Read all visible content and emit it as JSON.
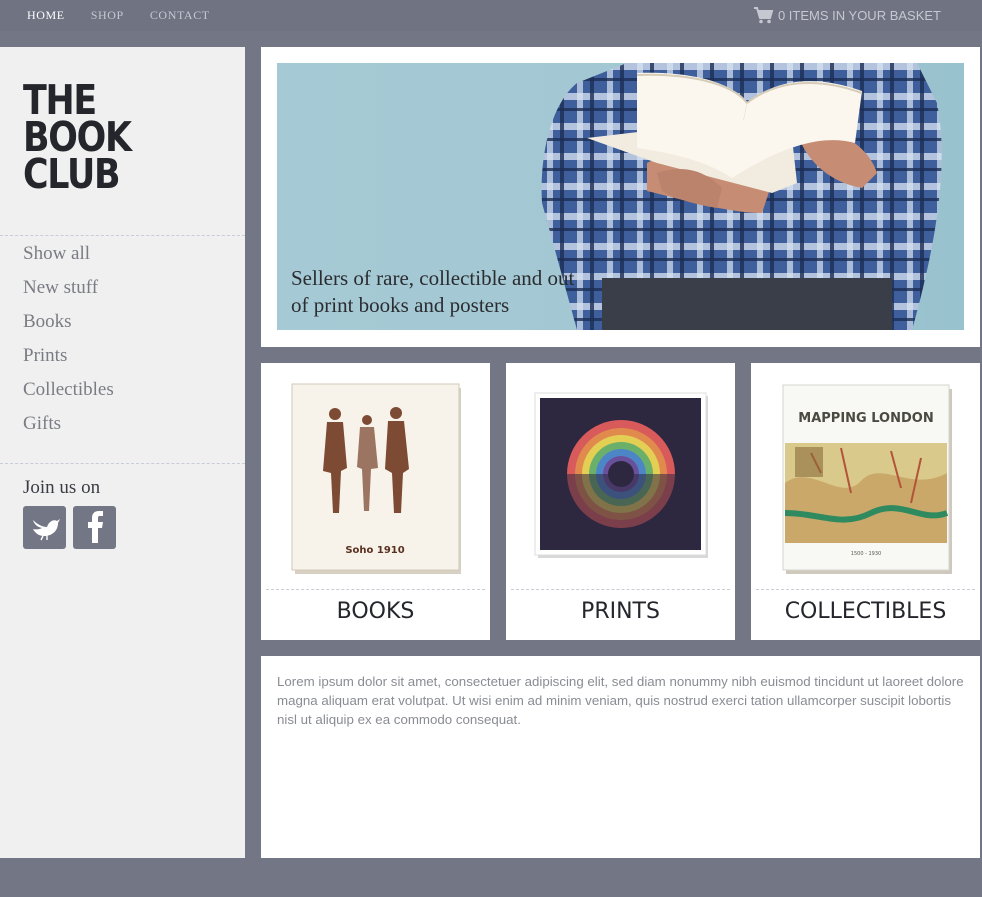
{
  "nav": {
    "items": [
      {
        "label": "HOME",
        "active": true
      },
      {
        "label": "SHOP",
        "active": false
      },
      {
        "label": "CONTACT",
        "active": false
      }
    ],
    "basket": {
      "icon": "cart-icon",
      "label": "0 ITEMS IN YOUR BASKET"
    }
  },
  "sidebar": {
    "logo": [
      "THE",
      "BOOK",
      "CLUB"
    ],
    "menu": [
      "Show all",
      "New stuff",
      "Books",
      "Prints",
      "Collectibles",
      "Gifts"
    ],
    "join_label": "Join us on",
    "social": [
      {
        "icon": "twitter-bird-icon"
      },
      {
        "icon": "facebook-icon"
      }
    ]
  },
  "hero": {
    "caption_line1": "Sellers of rare, collectible and out",
    "caption_line2": "of print books and posters"
  },
  "categories": [
    {
      "label": "BOOKS",
      "cover_text": "Soho 1910"
    },
    {
      "label": "PRINTS"
    },
    {
      "label": "COLLECTIBLES",
      "cover_title": "MAPPING LONDON",
      "cover_sub": "1500 - 1930"
    }
  ],
  "body_text": "Lorem ipsum dolor sit amet, consectetuer adipiscing elit, sed diam nonummy nibh euismod tincidunt ut laoreet dolore magna aliquam erat volutpat. Ut wisi enim ad minim veniam, quis nostrud exerci tation ullamcorper suscipit lobortis nisl ut aliquip ex ea commodo consequat.",
  "colors": {
    "frame": "#737785",
    "sidebar": "#f0f0f0",
    "hero_bg": "#a3c8d3"
  }
}
